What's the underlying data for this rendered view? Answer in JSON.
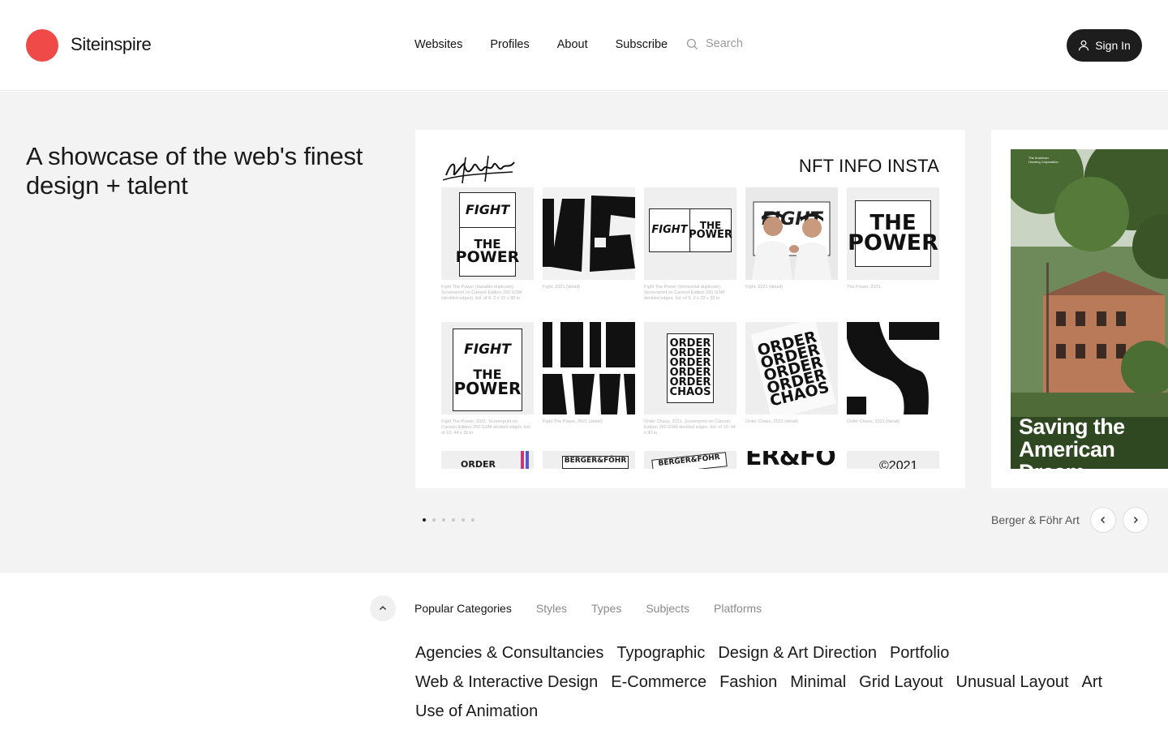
{
  "brand": {
    "name": "Siteinspire",
    "color": "#f04a48"
  },
  "nav": {
    "items": [
      "Websites",
      "Profiles",
      "About",
      "Subscribe"
    ]
  },
  "search": {
    "placeholder": "Search"
  },
  "signin": {
    "label": "Sign In"
  },
  "hero": {
    "tagline": "A showcase of the web's finest design + talent",
    "featured": {
      "site_name": "Berger & Föhr Art",
      "header_text": "NFT INFO INSTA",
      "slide_count": 6,
      "active_slide": 1,
      "posters": {
        "fight": "FIGHT",
        "the": "THE",
        "power": "POWER",
        "order": "ORDER",
        "chaos": "CHAOS",
        "berger": "BERGER&FÖHR"
      },
      "captions": [
        "Fight The Power (Variable duplicate). Screenprint on Canson Edition 250 GSM (deckled edges). Ed. of 8. 2 x 22 x 30 in",
        "Fight, 2021 (detail)",
        "Fight The Power (Horizontal duplicate). Screenprint on Canson Edition 250 GSM deckled edges. Ed. of 5. 2 x 22 x 30 in",
        "Fight, 2021 (detail)",
        "The Power, 2021",
        "Fight The Power, 2021. Screenprint on Canson Edition 250 GSM deckled edges. Ed. of 10. 44 x 30 in",
        "Fight The Power, 2021 (detail)",
        "Order Chaos, 2021. Screenprint on Canson Edition 250 GSM deckled edges. Ed. of 10. 44 x 30 in",
        "Order Chaos, 2021 (detail)",
        "Order Chaos, 2021 (detail)"
      ]
    },
    "next_preview": {
      "title": "Saving the American Dream",
      "org": "The American Housing Corporation"
    }
  },
  "categories": {
    "tabs": [
      "Popular Categories",
      "Styles",
      "Types",
      "Subjects",
      "Platforms"
    ],
    "active_tab": "Popular Categories",
    "items": [
      "Agencies & Consultancies",
      "Typographic",
      "Design & Art Direction",
      "Portfolio",
      "Web & Interactive Design",
      "E-Commerce",
      "Fashion",
      "Minimal",
      "Grid Layout",
      "Unusual Layout",
      "Art",
      "Use of Animation"
    ]
  }
}
